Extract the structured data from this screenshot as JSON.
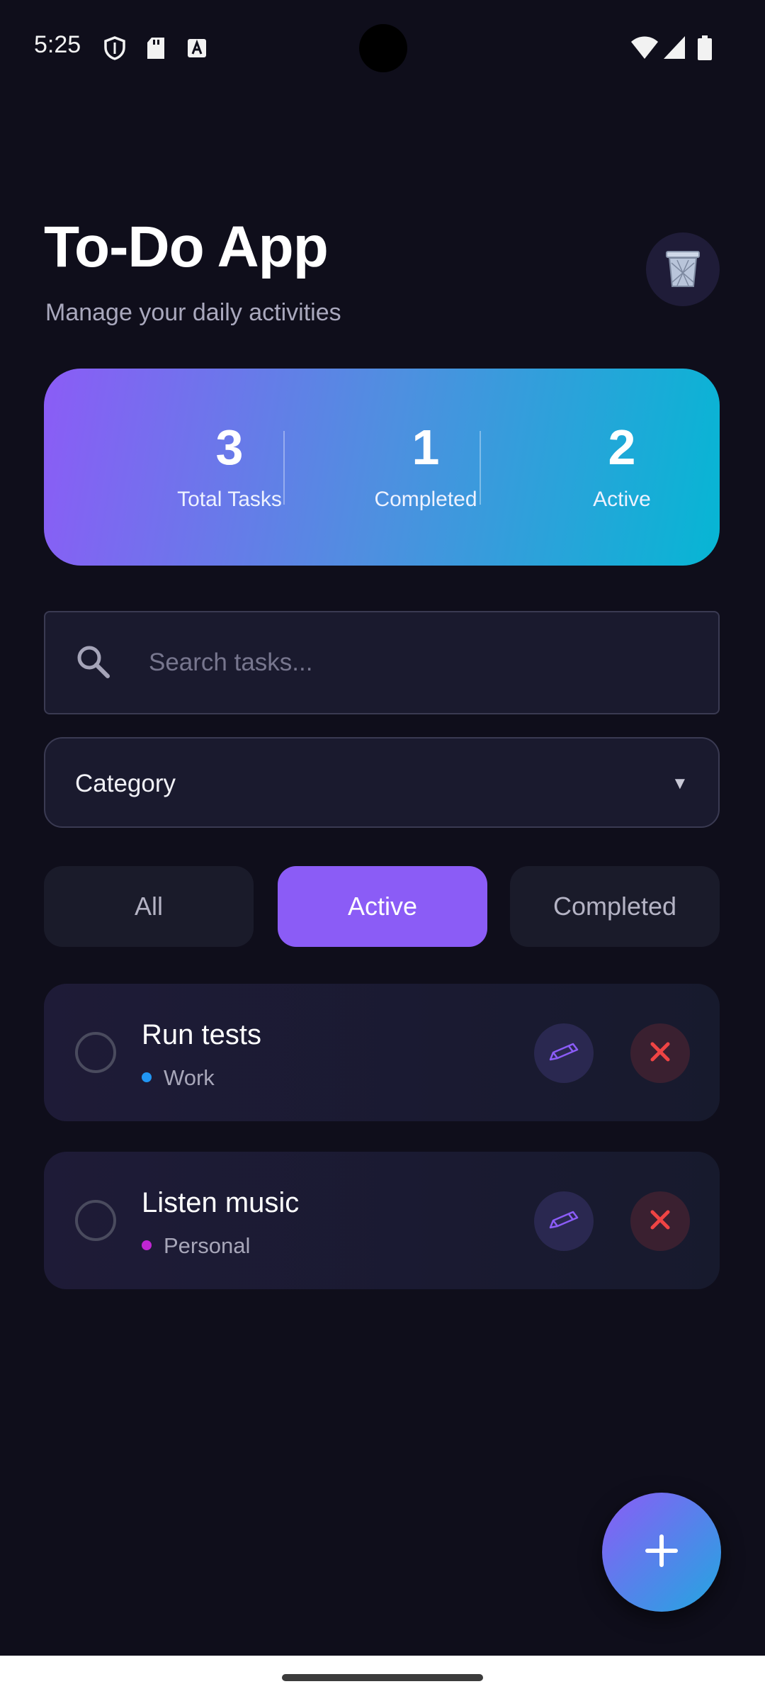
{
  "status_bar": {
    "time": "5:25"
  },
  "header": {
    "title": "To-Do App",
    "subtitle": "Manage your daily activities"
  },
  "stats": [
    {
      "value": "3",
      "label": "Total Tasks"
    },
    {
      "value": "1",
      "label": "Completed"
    },
    {
      "value": "2",
      "label": "Active"
    }
  ],
  "search": {
    "placeholder": "Search tasks...",
    "value": ""
  },
  "category": {
    "label": "Category",
    "arrow": "▼"
  },
  "filters": [
    {
      "label": "All",
      "selected": false
    },
    {
      "label": "Active",
      "selected": true
    },
    {
      "label": "Completed",
      "selected": false
    }
  ],
  "tasks": [
    {
      "title": "Run tests",
      "category": "Work",
      "dot_color": "#2196f3"
    },
    {
      "title": "Listen music",
      "category": "Personal",
      "dot_color": "#c026d3"
    }
  ],
  "icons": {
    "trash": "trash-icon",
    "search": "search-icon",
    "edit": "pencil-icon",
    "delete": "close-icon",
    "add": "plus-icon"
  },
  "colors": {
    "background": "#0f0e1b",
    "accent": "#8b5cf6",
    "gradient_end": "#06b6d4",
    "delete": "#ef4444"
  }
}
